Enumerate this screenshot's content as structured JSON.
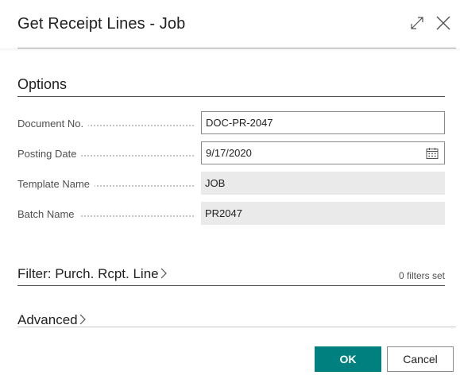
{
  "dialog": {
    "title": "Get Receipt Lines - Job",
    "expand_icon": "expand-icon",
    "close_icon": "close-icon"
  },
  "options": {
    "heading": "Options",
    "fields": [
      {
        "label": "Document No.",
        "value": "DOC-PR-2047",
        "editable": true
      },
      {
        "label": "Posting Date",
        "value": "9/17/2020",
        "editable": true,
        "icon": "calendar-icon"
      },
      {
        "label": "Template Name",
        "value": "JOB",
        "editable": false
      },
      {
        "label": "Batch Name",
        "value": "PR2047",
        "editable": false
      }
    ]
  },
  "filter": {
    "heading": "Filter: Purch. Rcpt. Line",
    "status": "0 filters set"
  },
  "advanced": {
    "heading": "Advanced"
  },
  "buttons": {
    "ok": "OK",
    "cancel": "Cancel"
  },
  "colors": {
    "accent": "#00807f",
    "readonly_bg": "#eaeaea"
  }
}
